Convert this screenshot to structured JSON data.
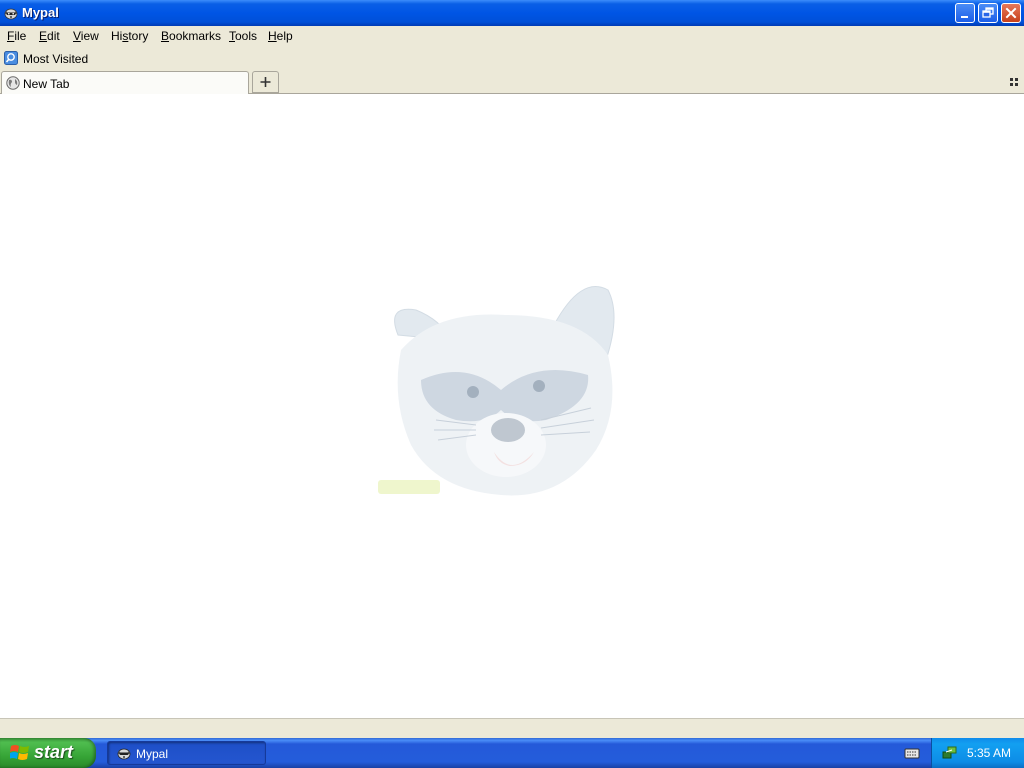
{
  "window": {
    "title": "Mypal",
    "app_icon": "raccoon-icon",
    "controls": [
      "minimize-icon",
      "restore-icon",
      "close-icon"
    ]
  },
  "menu": {
    "file": {
      "pre": "",
      "accel": "F",
      "post": "ile"
    },
    "edit": {
      "pre": "",
      "accel": "E",
      "post": "dit"
    },
    "view": {
      "pre": "",
      "accel": "V",
      "post": "iew"
    },
    "history": {
      "pre": "Hi",
      "accel": "s",
      "post": "tory"
    },
    "bookmarks": {
      "pre": "",
      "accel": "B",
      "post": "ookmarks"
    },
    "tools": {
      "pre": "",
      "accel": "T",
      "post": "ools"
    },
    "help": {
      "pre": "",
      "accel": "H",
      "post": "elp"
    }
  },
  "bookmarks_toolbar": {
    "items": [
      {
        "label": "Most Visited",
        "icon": "most-visited-icon"
      }
    ]
  },
  "tabs": {
    "items": [
      {
        "label": "New Tab",
        "icon": "globe-icon",
        "active": true
      }
    ],
    "new_tab_icon": "plus-icon",
    "all_tabs_icon": "list-all-tabs-icon"
  },
  "content": {
    "watermark": "raccoon-logo"
  },
  "taskbar": {
    "start_label": "start",
    "tasks": [
      {
        "label": "Mypal",
        "icon": "raccoon-icon",
        "active": true
      }
    ],
    "tray_icons": [
      "keyboard-icon",
      "network-icon"
    ],
    "clock": "5:35 AM"
  },
  "colors": {
    "titlebar": "#0055e5",
    "chrome": "#ece9d8",
    "taskbar": "#245ddb",
    "start_button": "#37a537",
    "tray": "#0f8bea"
  }
}
